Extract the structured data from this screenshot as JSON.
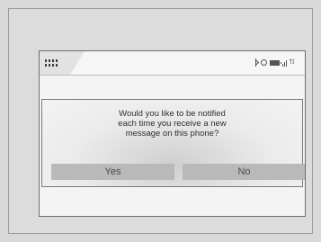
{
  "status_bar": {
    "menu_icon": "grid-menu-icon",
    "icons": [
      "bluetooth-icon",
      "ring-icon",
      "battery-icon",
      "signal-icon"
    ],
    "signal_text": "T.l"
  },
  "dialog": {
    "message": "Would you like to be notified\neach time you receive a new\nmessage on this phone?",
    "yes_label": "Yes",
    "no_label": "No"
  }
}
